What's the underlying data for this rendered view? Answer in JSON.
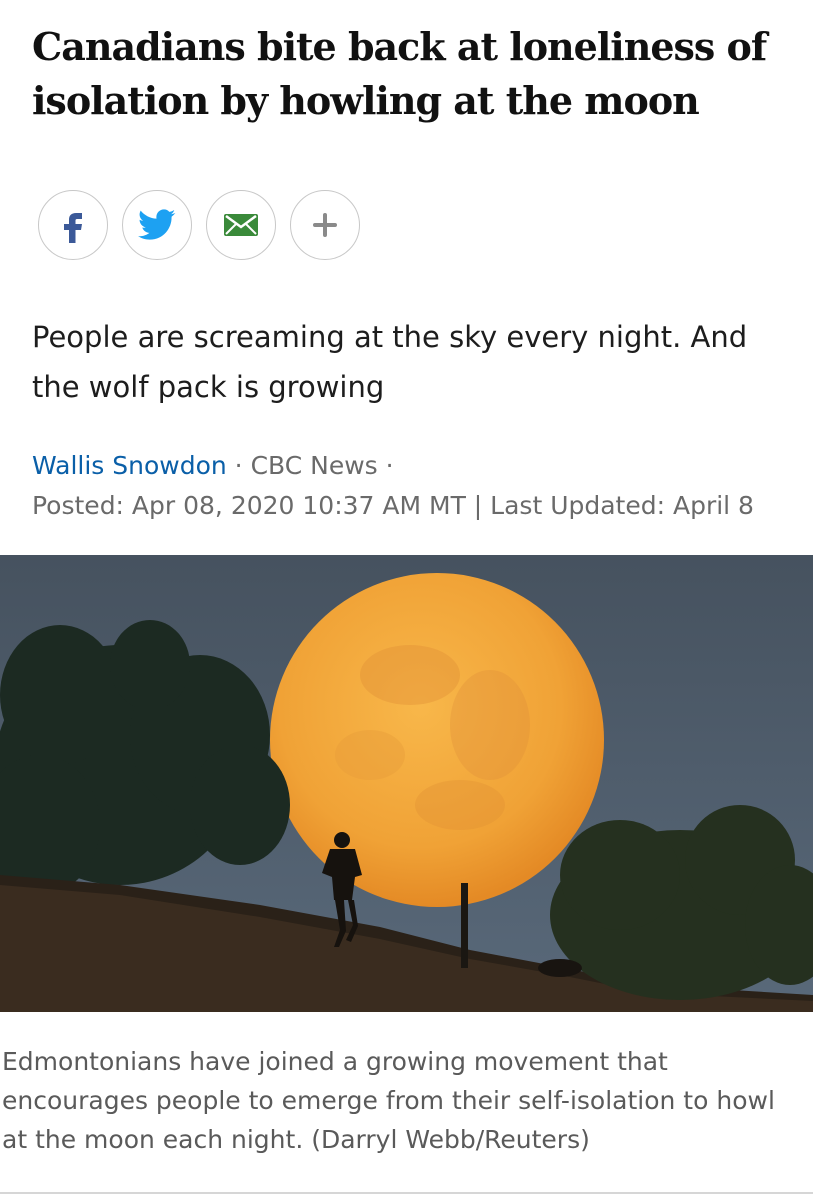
{
  "article": {
    "headline": "Canadians bite back at loneliness of isolation by howling at the moon",
    "dek": "People are screaming at the sky every night. And the wolf pack is growing",
    "author": "Wallis Snowdon",
    "sep1": " · ",
    "outlet": "CBC News",
    "sep2": " ·",
    "posted": "Posted: Apr 08, 2020 10:37 AM MT | Last Updated: April 8",
    "caption": "Edmontonians have joined a growing movement that encourages people to emerge from their self-isolation to howl at the moon each night. (Darryl Webb/Reuters)"
  },
  "share": [
    {
      "icon": "facebook-icon",
      "color": "#3b5998"
    },
    {
      "icon": "twitter-icon",
      "color": "#1da1f2"
    },
    {
      "icon": "email-icon",
      "color": "#3a8a3a"
    },
    {
      "icon": "plus-icon",
      "color": "#8a8a8a"
    }
  ],
  "colors": {
    "link": "#0a5fa8",
    "sky": "#4f5f6c",
    "moon": "#f2a23a"
  }
}
